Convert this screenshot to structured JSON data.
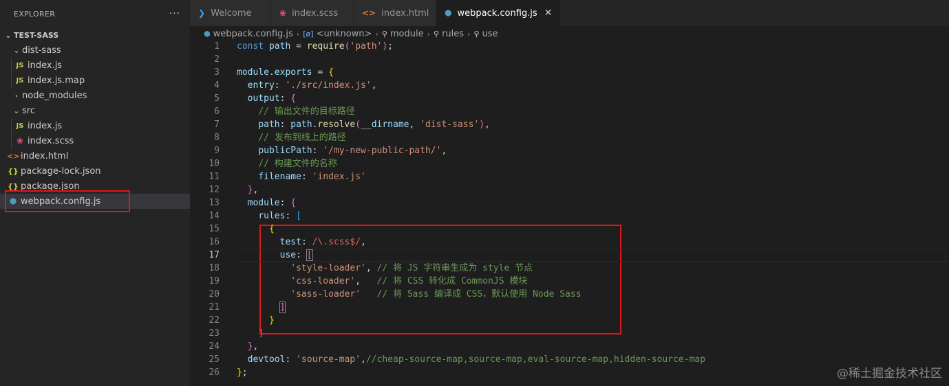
{
  "explorer": {
    "title": "EXPLORER",
    "more": "···",
    "project": "TEST-SASS",
    "items": [
      {
        "label": "dist-sass",
        "type": "folder",
        "expanded": true,
        "depth": 1
      },
      {
        "label": "index.js",
        "type": "js",
        "depth": 2
      },
      {
        "label": "index.js.map",
        "type": "js",
        "depth": 2
      },
      {
        "label": "node_modules",
        "type": "folder",
        "expanded": false,
        "depth": 1
      },
      {
        "label": "src",
        "type": "folder",
        "expanded": true,
        "depth": 1
      },
      {
        "label": "index.js",
        "type": "js",
        "depth": 2
      },
      {
        "label": "index.scss",
        "type": "scss",
        "depth": 2
      },
      {
        "label": "index.html",
        "type": "html",
        "depth": 1
      },
      {
        "label": "package-lock.json",
        "type": "json",
        "depth": 1
      },
      {
        "label": "package.json",
        "type": "json",
        "depth": 1
      },
      {
        "label": "webpack.config.js",
        "type": "webpack",
        "depth": 1,
        "selected": true
      }
    ]
  },
  "tabs": [
    {
      "label": "Welcome",
      "icon": "vscode-icon",
      "active": false
    },
    {
      "label": "index.scss",
      "icon": "scss-icon",
      "active": false
    },
    {
      "label": "index.html",
      "icon": "html-icon",
      "active": false
    },
    {
      "label": "webpack.config.js",
      "icon": "webpack-icon",
      "active": true,
      "close": "✕"
    }
  ],
  "breadcrumb": [
    "webpack.config.js",
    "<unknown>",
    "module",
    "rules",
    "use"
  ],
  "editor": {
    "current_line": 17,
    "lines": [
      "const path = require('path');",
      "",
      "module.exports = {",
      "  entry: './src/index.js',",
      "  output: {",
      "    // 输出文件的目标路径",
      "    path: path.resolve(__dirname, 'dist-sass'),",
      "    // 发布到线上的路径",
      "    publicPath: '/my-new-public-path/',",
      "    // 构建文件的名称",
      "    filename: 'index.js'",
      "  },",
      "  module: {",
      "    rules: [",
      "      {",
      "        test: /\\.scss$/,",
      "        use: [",
      "          'style-loader', // 将 JS 字符串生成为 style 节点",
      "          'css-loader',   // 将 CSS 转化成 CommonJS 模块",
      "          'sass-loader'   // 将 Sass 编译成 CSS，默认使用 Node Sass",
      "        ]",
      "      }",
      "    ]",
      "  },",
      "  devtool: 'source-map',//cheap-source-map,source-map,eval-source-map,hidden-source-map",
      "};"
    ]
  },
  "watermark": "@稀土掘金技术社区",
  "colors": {
    "highlight_box": "#e0161a",
    "editor_bg": "#1e1e1e",
    "sidebar_bg": "#252526"
  }
}
